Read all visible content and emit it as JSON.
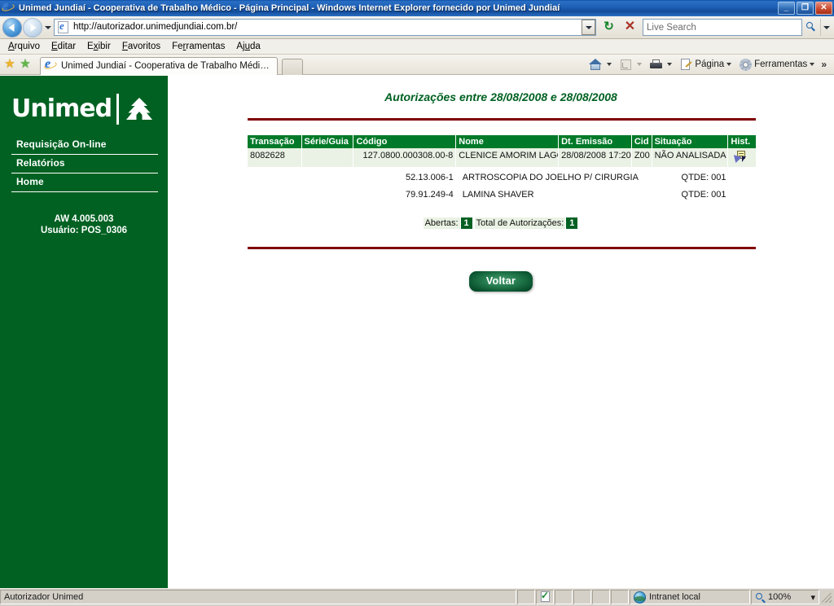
{
  "window": {
    "title": "Unimed Jundiaí - Cooperativa de Trabalho Médico - Página Principal - Windows Internet Explorer fornecido por Unimed Jundiaí",
    "minimize_label": "_",
    "maximize_label": "❐",
    "close_label": "✕"
  },
  "navbar": {
    "back_title": "Voltar",
    "forward_title": "Avançar",
    "address_value": "http://autorizador.unimedjundiai.com.br/",
    "refresh_label": "↻",
    "stop_label": "✕",
    "search_placeholder": "Live Search",
    "search_value": ""
  },
  "menubar": {
    "items": [
      {
        "prefix": "",
        "accel": "A",
        "suffix": "rquivo"
      },
      {
        "prefix": "",
        "accel": "E",
        "suffix": "ditar"
      },
      {
        "prefix": "E",
        "accel": "x",
        "suffix": "ibir"
      },
      {
        "prefix": "",
        "accel": "F",
        "suffix": "avoritos"
      },
      {
        "prefix": "Fe",
        "accel": "r",
        "suffix": "ramentas"
      },
      {
        "prefix": "Aj",
        "accel": "u",
        "suffix": "da"
      }
    ]
  },
  "tabbar": {
    "favorites_icon": "★",
    "add_favorite_icon": "★",
    "tab_label": "Unimed Jundiaí - Cooperativa de Trabalho Médico - Pá...",
    "newtab_label": ""
  },
  "commandbar": {
    "home_label": "",
    "feeds_label": "",
    "print_label": "",
    "page_label": "Página",
    "tools_label": "Ferramentas",
    "overflow_label": "»"
  },
  "sidebar": {
    "logo_word": "Unimed",
    "items": [
      {
        "label": "Requisição On-line"
      },
      {
        "label": "Relatórios"
      },
      {
        "label": "Home"
      }
    ],
    "version": "AW 4.005.003",
    "user": "Usuário: POS_0306"
  },
  "main": {
    "page_title": "Autorizações entre 28/08/2008 e 28/08/2008",
    "table": {
      "headers": [
        "Transação",
        "Série/Guia",
        "Código",
        "Nome",
        "Dt. Emissão",
        "Cid",
        "Situação",
        "Hist."
      ],
      "row": {
        "transacao": "8082628",
        "serie_guia": "",
        "codigo": "127.0800.000308.00-8",
        "nome": "CLENICE AMORIM LAGO",
        "dt_emissao": "28/08/2008 17:20",
        "cid": "Z00",
        "situacao": "NÃO ANALISADA",
        "hist_icon": "history-document-icon"
      },
      "procedures": [
        {
          "codigo": "52.13.006-1",
          "nome": "ARTROSCOPIA DO JOELHO P/ CIRURGIA",
          "qtde": "QTDE: 001"
        },
        {
          "codigo": "79.91.249-4",
          "nome": "LAMINA SHAVER",
          "qtde": "QTDE: 001"
        }
      ]
    },
    "totals": {
      "abertas_label": "Abertas:",
      "abertas_value": "1",
      "total_label": "Total de Autorizações:",
      "total_value": "1"
    },
    "back_button": "Voltar"
  },
  "statusbar": {
    "message": "Autorizador Unimed",
    "zone": "Intranet local",
    "zoom": "100%",
    "zoom_caret": "▾"
  },
  "colors": {
    "unimed_green": "#006122",
    "header_green": "#007a28",
    "rule_maroon": "#800000",
    "row_bg": "#e9f2e4",
    "title_blue": "#1c5fb5"
  }
}
